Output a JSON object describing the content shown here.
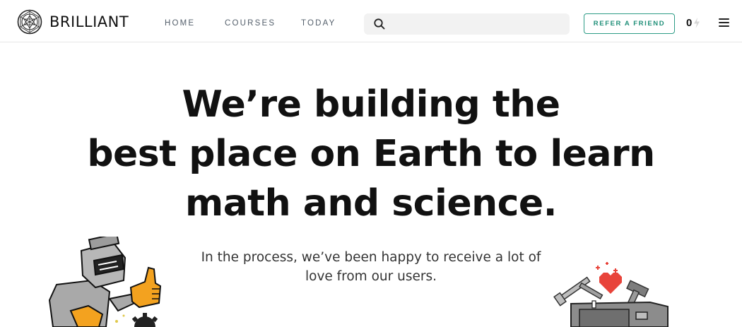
{
  "brand": {
    "name": "BRILLIANT",
    "icon": "brilliant-globe-icon"
  },
  "nav": {
    "links": [
      "HOME",
      "COURSES",
      "TODAY"
    ],
    "search": {
      "placeholder": "",
      "value": "",
      "icon": "search-icon"
    },
    "refer_label": "REFER A FRIEND",
    "streak_count": "0",
    "streak_icon": "lightning-bolt-icon",
    "menu_icon": "hamburger-menu-icon"
  },
  "hero": {
    "title_lines": [
      "We’re building the",
      "best place on Earth to learn",
      "math and science."
    ],
    "subtitle_lines": [
      "In the process, we’ve been happy to receive a lot of",
      "love from our users."
    ]
  },
  "colors": {
    "accent": "#2d9c86",
    "nav_text": "#55606c",
    "search_bg": "#f2f2f2",
    "heart": "#e8433a"
  }
}
